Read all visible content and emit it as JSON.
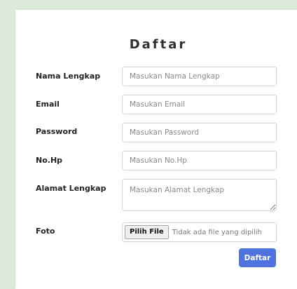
{
  "form": {
    "title": "Daftar",
    "fields": {
      "nama": {
        "label": "Nama Lengkap",
        "placeholder": "Masukan Nama Lengkap"
      },
      "email": {
        "label": "Email",
        "placeholder": "Masukan Email"
      },
      "password": {
        "label": "Password",
        "placeholder": "Masukan Password"
      },
      "nohp": {
        "label": "No.Hp",
        "placeholder": "Masukan No.Hp"
      },
      "alamat": {
        "label": "Alamat Lengkap",
        "placeholder": "Masukan Alamat Lengkap"
      }
    },
    "foto": {
      "label": "Foto",
      "button_label": "Pilih File",
      "status_text": "Tidak ada file yang dipilih"
    },
    "submit_label": "Daftar"
  },
  "colors": {
    "background": "#dcebd9",
    "card": "#ffffff",
    "accent": "#4e73df"
  }
}
